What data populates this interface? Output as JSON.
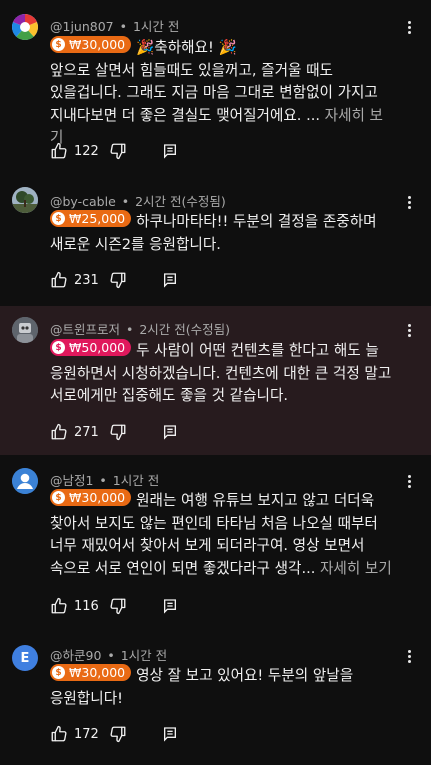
{
  "comments": [
    {
      "author": "@1jun807",
      "time": "1시간 전",
      "edited": "",
      "chip_amount": "₩30,000",
      "chip_color": "#e96a14",
      "avatar_letter": "",
      "avatar_bg": "#2f6fd8",
      "avatar_icon": "colorful-pinwheel-icon",
      "lines": [
        "🎉축하해요! 🎉",
        "앞으로 살면서 힘들때도 있을꺼고, 즐거울 때도",
        "있을겁니다. 그래도 지금 마음 그대로 변함없이 가지고",
        "지내다보면 더 좋은 결실도 맺어질거에요. ..."
      ],
      "see_more": "자세히 보기",
      "likes": "122",
      "highlight": false
    },
    {
      "author": "@by-cable",
      "time": "2시간 전",
      "edited": "(수정됨)",
      "chip_amount": "₩25,000",
      "chip_color": "#e96a14",
      "avatar_letter": "",
      "avatar_bg": "#6b7d8e",
      "avatar_icon": "tree-photo-icon",
      "lines": [
        "하쿠나마타타!! 두분의 결정을 존중하며",
        "새로운 시즌2를 응원합니다."
      ],
      "see_more": "",
      "likes": "231",
      "highlight": false
    },
    {
      "author": "@트윈프로저",
      "time": "2시간 전",
      "edited": "(수정됨)",
      "chip_amount": "₩50,000",
      "chip_color": "#e0185c",
      "avatar_letter": "",
      "avatar_bg": "#7a7f86",
      "avatar_icon": "robot-photo-icon",
      "lines": [
        "두 사람이 어떤 컨텐츠를 한다고 해도 늘",
        "응원하면서 시청하겠습니다. 컨텐츠에 대한 큰 걱정 말고",
        "서로에게만 집중해도 좋을 것 같습니다."
      ],
      "see_more": "",
      "likes": "271",
      "highlight": true
    },
    {
      "author": "@남정1",
      "time": "1시간 전",
      "edited": "",
      "chip_amount": "₩30,000",
      "chip_color": "#e96a14",
      "avatar_letter": "",
      "avatar_bg": "#3b82d6",
      "avatar_icon": "default-person-icon",
      "lines": [
        "원래는 여행 유튜브 보지고 않고 더더욱",
        "찾아서 보지도 않는 편인데 타타님 처음 나오실 때부터",
        "너무 재밌어서 찾아서 보게 되더라구여. 영상 보면서",
        "속으로 서로 연인이 되면 좋겠다라구 생각..."
      ],
      "see_more": "자세히 보기",
      "likes": "116",
      "highlight": false
    },
    {
      "author": "@하쿤90",
      "time": "1시간 전",
      "edited": "",
      "chip_amount": "₩30,000",
      "chip_color": "#e96a14",
      "avatar_letter": "E",
      "avatar_bg": "#3f7fe0",
      "avatar_icon": "letter-avatar",
      "lines": [
        "영상 잘 보고 있어요!  두분의 앞날을",
        "응원합니다!"
      ],
      "see_more": "",
      "likes": "172",
      "highlight": false
    }
  ],
  "icons": {
    "like": "thumbs-up-icon",
    "dislike": "thumbs-down-icon",
    "reply": "reply-comment-icon",
    "more": "more-vertical-icon"
  },
  "colors": {
    "background": "#0f0f0f",
    "highlight_background": "#271b1e",
    "secondary_text": "#aaaaaa"
  }
}
